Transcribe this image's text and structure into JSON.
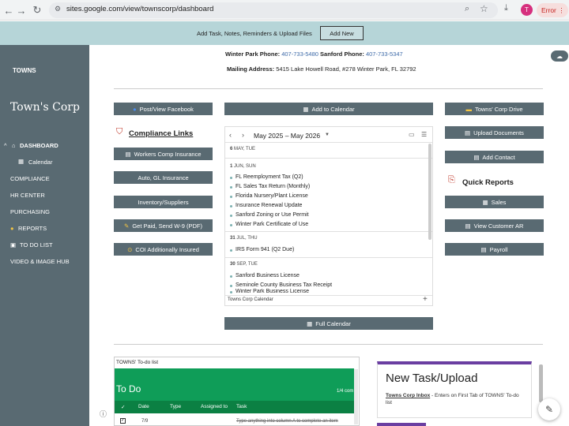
{
  "browser": {
    "url": "sites.google.com/view/townscorp/dashboard",
    "profile_initial": "T",
    "error_label": "Error"
  },
  "banner": {
    "text": "Add Task, Notes, Reminders & Upload Files",
    "button": "Add New"
  },
  "sidebar": {
    "logo": "TOWNS",
    "site_title": "Town's Corp",
    "items": [
      {
        "label": "DASHBOARD",
        "expanded": true
      },
      {
        "label": "Calendar",
        "sub": true
      },
      {
        "label": "COMPLIANCE"
      },
      {
        "label": "HR CENTER"
      },
      {
        "label": "PURCHASING"
      },
      {
        "label": "REPORTS"
      },
      {
        "label": "TO DO LIST"
      },
      {
        "label": "VIDEO & IMAGE HUB"
      }
    ]
  },
  "header": {
    "wp_label": "Winter Park Phone:",
    "wp_phone": "407-733-5480",
    "sf_label": "Sanford Phone:",
    "sf_phone": "407-733-5347",
    "mail_label": "Mailing Address:",
    "mail_value": "5415 Lake Howell Road, #278 Winter Park, FL 32792"
  },
  "left_col": {
    "facebook": "Post/View Facebook",
    "compliance_title": "Compliance Links",
    "buttons": [
      "Workers Comp Insurance",
      "Auto, GL Insurance",
      "Inventory/Suppliers",
      "Get Paid, Send W-9 (PDF)",
      "COI Additionally Insured"
    ]
  },
  "mid_col": {
    "add_calendar": "Add to Calendar",
    "full_calendar": "Full Calendar"
  },
  "calendar": {
    "range": "May 2025 – May 2026",
    "footer": "Towns Corp Calendar",
    "groups": [
      {
        "date": "6",
        "dow": "MAY, TUE",
        "events": []
      },
      {
        "date": "1",
        "dow": "JUN, SUN",
        "events": [
          "FL Reemployment Tax (Q2)",
          "FL Sales Tax Return (Monthly)",
          "Florida Nursery/Plant License",
          "Insurance Renewal Update",
          "Sanford Zoning or Use Permit",
          "Winter Park Certificate of Use"
        ]
      },
      {
        "date": "31",
        "dow": "JUL, THU",
        "events": [
          "IRS Form 941 (Q2 Due)"
        ]
      },
      {
        "date": "30",
        "dow": "SEP, TUE",
        "events": [
          "Sanford Business License",
          "Seminole County Business Tax Receipt",
          "Winter Park Business License"
        ]
      }
    ]
  },
  "right_col": {
    "buttons_top": [
      "Towns' Corp Drive",
      "Upload Documents",
      "Add Contact"
    ],
    "quick_reports_title": "Quick Reports",
    "buttons_reports": [
      "Sales",
      "View Customer AR",
      "Payroll"
    ]
  },
  "todo": {
    "sheet_title": "TOWNS' To-do list",
    "heading": "To Do",
    "count": "1/4 com",
    "columns": [
      "✓",
      "Date",
      "Type",
      "Assigned to",
      "Task"
    ],
    "row": {
      "date": "7/9",
      "task": "Type anything into column A to complete an item"
    }
  },
  "newtask": {
    "title": "New Task/Upload",
    "link": "Towns Corp Inbox",
    "text": " - Enters on First Tab of TOWNS' To-do list"
  },
  "colors": {
    "sidebar": "#596a72",
    "banner": "#b6d5d8",
    "todo_green": "#0f9d58",
    "accent_purple": "#6a3ea1"
  }
}
